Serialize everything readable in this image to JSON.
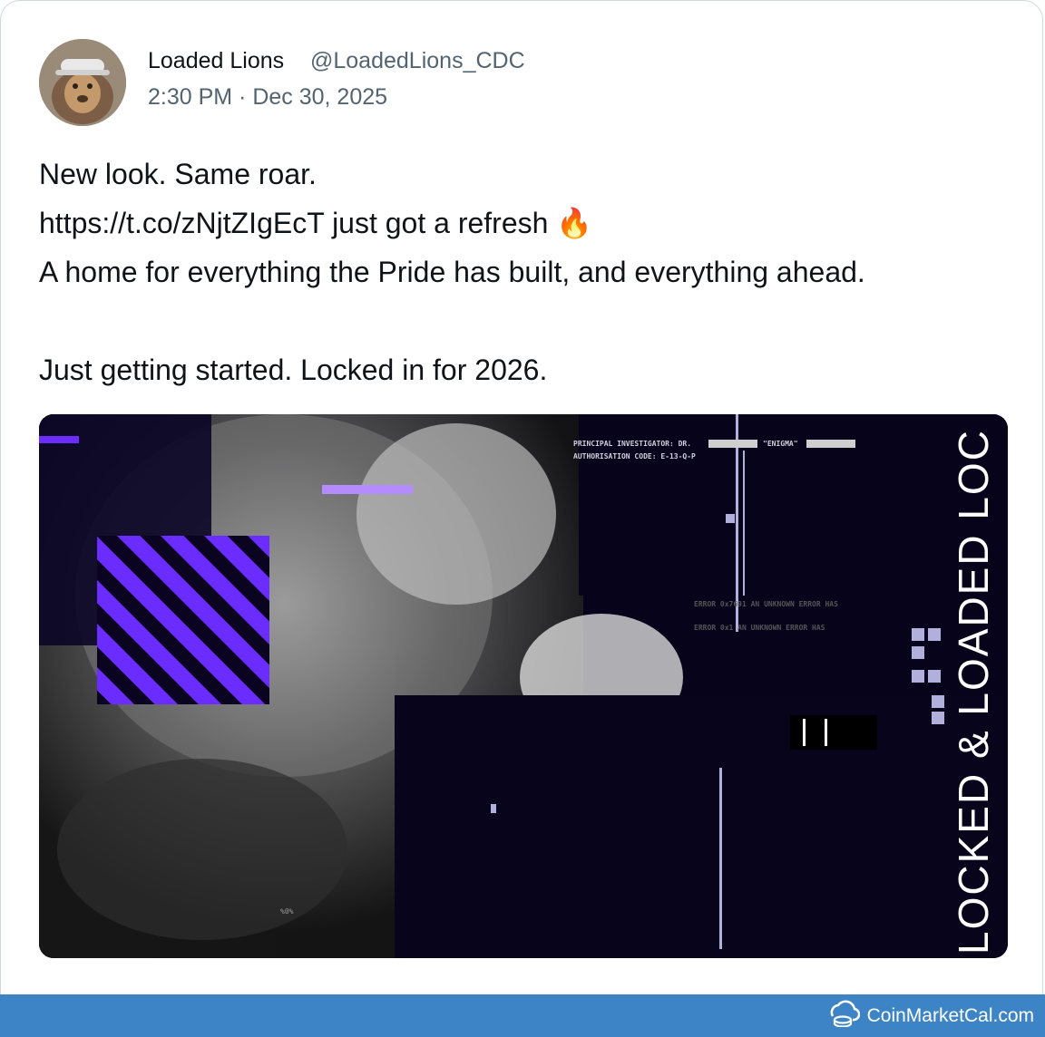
{
  "tweet": {
    "author": {
      "display_name": "Loaded Lions",
      "handle": "@LoadedLions_CDC",
      "avatar_icon": "lion-avatar-icon"
    },
    "timestamp": "2:30 PM · Dec 30, 2025",
    "lines": [
      "New look. Same roar.",
      "https://t.co/zNjtZIgEcT just got a refresh 🔥",
      "A home for everything the Pride has built, and everything ahead.",
      "",
      "Just getting started. Locked in for 2026."
    ],
    "media": {
      "vertical_text": "LOCKED & LOADED LOC",
      "investigator_line": "PRINCIPAL INVESTIGATOR: DR.",
      "enigma_label": "\"ENIGMA\"",
      "authorisation_line": "AUTHORISATION CODE: E-13-Q-P",
      "error_line_1": "ERROR 0x7691 AN UNKNOWN ERROR HAS",
      "error_line_2": "ERROR 0x1 AN UNKNOWN ERROR HAS",
      "small_tag": "%0%"
    }
  },
  "footer": {
    "brand": "CoinMarketCal.com",
    "brand_icon": "coinmarketcal-logo-icon"
  },
  "colors": {
    "text_primary": "#0f1419",
    "text_secondary": "#536471",
    "media_purple": "#6a2cff",
    "footer_blue": "#3d84c6"
  }
}
